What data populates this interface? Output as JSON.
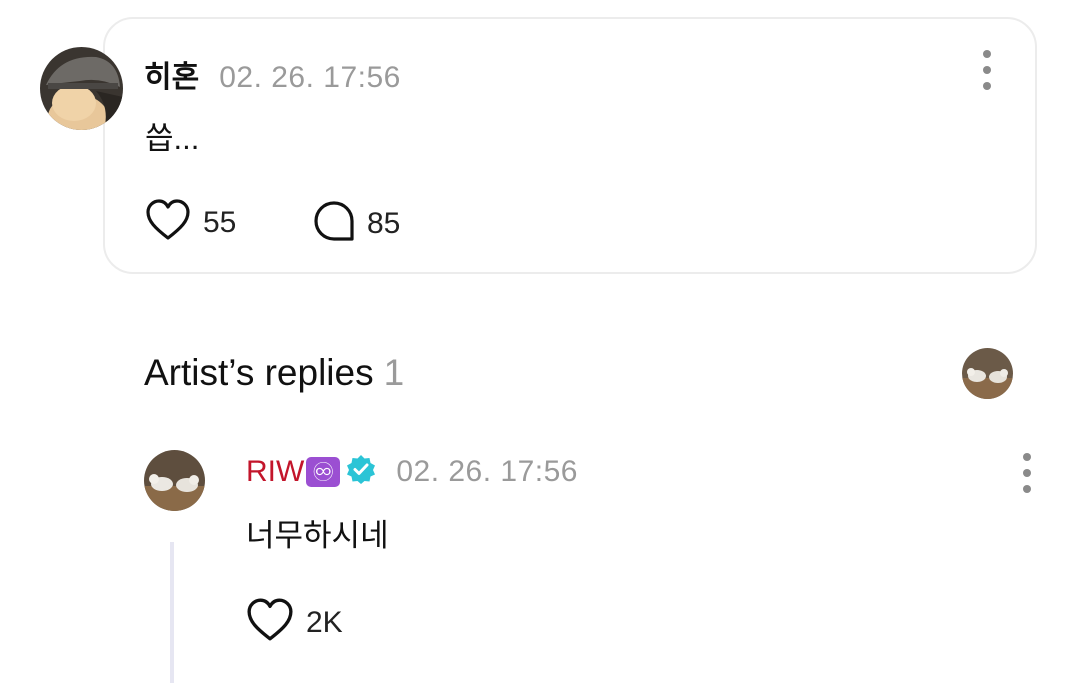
{
  "comment": {
    "author": "히혼",
    "timestamp": "02. 26. 17:56",
    "text": "씁...",
    "likes": "55",
    "replies": "85",
    "avatar_icon": "user-avatar-gray-hat"
  },
  "artist_replies": {
    "title": "Artist’s replies",
    "count": "1",
    "preview_avatar_icon": "artist-avatar-dogs"
  },
  "reply": {
    "author": "RIW",
    "badge": "♾",
    "badge_color": "#9b4fd2",
    "verified_color": "#2bc4d6",
    "name_color": "#c3152b",
    "timestamp": "02. 26. 17:56",
    "text": "너무하시네",
    "likes": "2K"
  }
}
